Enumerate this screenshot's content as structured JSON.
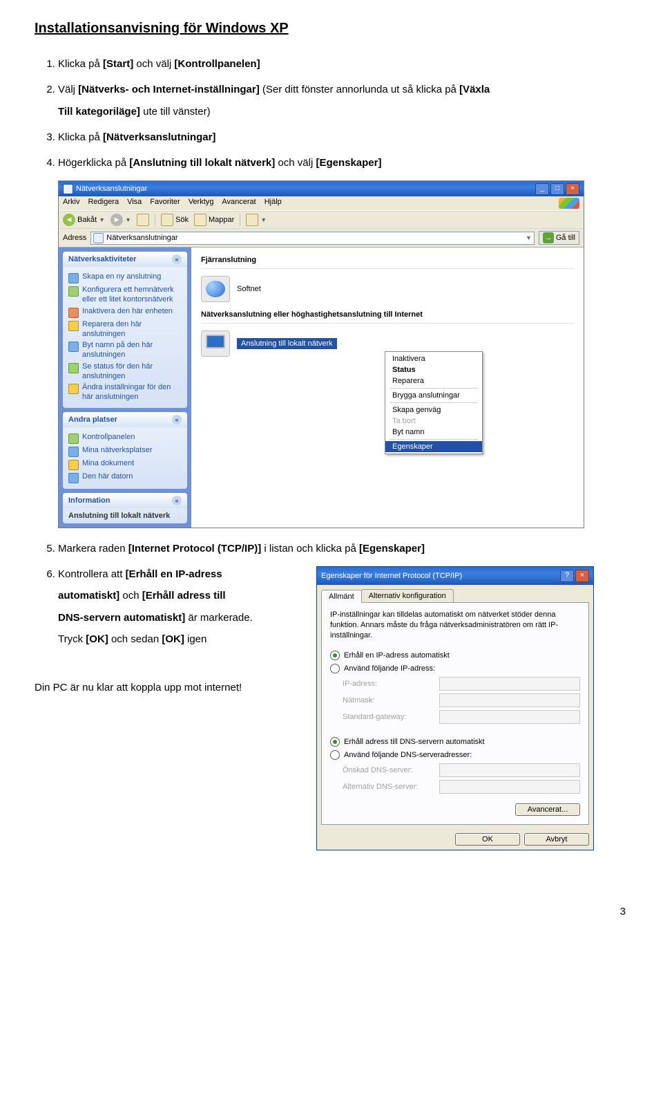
{
  "page": {
    "title": "Installationsanvisning för Windows XP",
    "final_line": "Din PC är nu klar att koppla upp mot internet!",
    "page_number": "3"
  },
  "steps": {
    "s1_pre": "Klicka på ",
    "s1_b1": "[Start]",
    "s1_mid": " och välj ",
    "s1_b2": "[Kontrollpanelen]",
    "s2_pre": "Välj ",
    "s2_b1": "[Nätverks- och Internet-inställningar]",
    "s2_mid": " (Ser ditt fönster annorlunda ut så klicka på ",
    "s2_b2": "[Växla",
    "s2_line2_b": "Till kategoriläge]",
    "s2_line2_after": " ute till vänster)",
    "s3_pre": "Klicka på ",
    "s3_b1": "[Nätverksanslutningar]",
    "s4_pre": "Högerklicka på ",
    "s4_b1": "[Anslutning till lokalt nätverk]",
    "s4_mid": " och välj ",
    "s4_b2": "[Egenskaper]",
    "s5_pre": "Markera raden ",
    "s5_b1": "[Internet Protocol (TCP/IP)]",
    "s5_mid": " i listan och klicka på ",
    "s5_b2": "[Egenskaper]",
    "s6_pre": "Kontrollera att ",
    "s6_b1": "[Erhåll en IP-adress",
    "s6_line2_b1": "automatiskt]",
    "s6_line2_mid": " och ",
    "s6_line2_b2": "[Erhåll adress till",
    "s6_line3_b": "DNS-servern automatiskt]",
    "s6_line3_after": " är markerade.",
    "s6_line4_pre": "Tryck ",
    "s6_line4_b1": "[OK]",
    "s6_line4_mid": " och sedan ",
    "s6_line4_b2": "[OK]",
    "s6_line4_after": " igen"
  },
  "xp": {
    "title": "Nätverksanslutningar",
    "menu": {
      "m1": "Arkiv",
      "m2": "Redigera",
      "m3": "Visa",
      "m4": "Favoriter",
      "m5": "Verktyg",
      "m6": "Avancerat",
      "m7": "Hjälp"
    },
    "tb": {
      "back": "Bakåt",
      "sok": "Sök",
      "mappar": "Mappar"
    },
    "addr": {
      "label": "Adress",
      "value": "Nätverksanslutningar",
      "go": "Gå till"
    },
    "side": {
      "p1_title": "Nätverksaktiviteter",
      "p1": {
        "i1": "Skapa en ny anslutning",
        "i2": "Konfigurera ett hemnätverk eller ett litet kontorsnätverk",
        "i3": "Inaktivera den här enheten",
        "i4": "Reparera den här anslutningen",
        "i5": "Byt namn på den här anslutningen",
        "i6": "Se status för den här anslutningen",
        "i7": "Ändra inställningar för den här anslutningen"
      },
      "p2_title": "Andra platser",
      "p2": {
        "i1": "Kontrollpanelen",
        "i2": "Mina nätverksplatser",
        "i3": "Mina dokument",
        "i4": "Den här datorn"
      },
      "p3_title": "Information",
      "p3_text": "Anslutning till lokalt nätverk"
    },
    "content": {
      "sec1": "Fjärranslutning",
      "sec1_item": "Softnet",
      "sec2": "Nätverksanslutning eller höghastighetsanslutning till Internet",
      "sel": "Anslutning till lokalt nätverk"
    },
    "ctx": {
      "c1": "Inaktivera",
      "c2": "Status",
      "c3": "Reparera",
      "c4": "Brygga anslutningar",
      "c5": "Skapa genväg",
      "c6": "Ta bort",
      "c7": "Byt namn",
      "c8": "Egenskaper"
    }
  },
  "dlg": {
    "title": "Egenskaper för Internet Protocol (TCP/IP)",
    "tab1": "Allmänt",
    "tab2": "Alternativ konfiguration",
    "desc": "IP-inställningar kan tilldelas automatiskt om nätverket stöder denna funktion. Annars måste du fråga nätverksadministratören om rätt IP-inställningar.",
    "r1": "Erhåll en IP-adress automatiskt",
    "r2": "Använd följande IP-adress:",
    "f1": "IP-adress:",
    "f2": "Nätmask:",
    "f3": "Standard-gateway:",
    "r3": "Erhåll adress till DNS-servern automatiskt",
    "r4": "Använd följande DNS-serveradresser:",
    "f4": "Önskad DNS-server:",
    "f5": "Alternativ DNS-server:",
    "adv": "Avancerat...",
    "ok": "OK",
    "cancel": "Avbryt"
  }
}
